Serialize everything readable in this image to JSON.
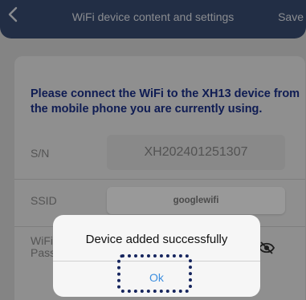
{
  "header": {
    "title": "WiFi device content and settings",
    "save_label": "Save"
  },
  "form": {
    "instruction": "Please connect the WiFi to the XH13 device from the mobile phone you are currently using.",
    "sn_label": "S/N",
    "sn_value": "XH202401251307",
    "ssid_label": "SSID",
    "ssid_value": "googlewifi",
    "password_label_line1": "WiFi",
    "password_label_line2": "Pass"
  },
  "dialog": {
    "message": "Device added successfully",
    "ok_label": "Ok"
  },
  "colors": {
    "header_bg": "#3a4d74",
    "instruction_text": "#1a2f8a",
    "ok_text": "#3d8fe0",
    "highlight_border": "#16255e"
  },
  "icons": [
    "back-chevron-icon",
    "eye-slash-icon"
  ]
}
